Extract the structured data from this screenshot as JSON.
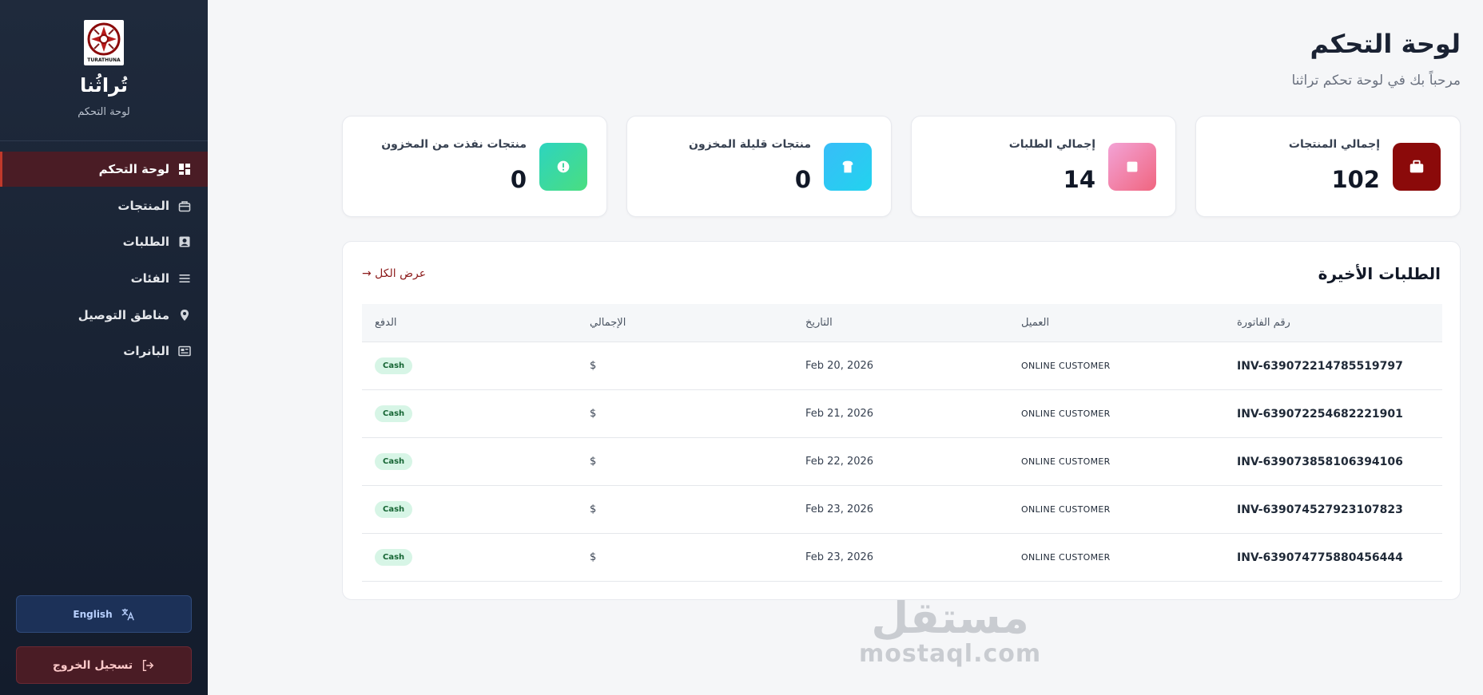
{
  "sidebar": {
    "logo_text": "TURATHUNA",
    "brand_name": "تُراثُنا",
    "brand_sub": "لوحة التحكم",
    "nav": [
      {
        "label": "لوحة التحكم",
        "icon": "dashboard-icon",
        "active": true
      },
      {
        "label": "المنتجات",
        "icon": "products-icon",
        "active": false
      },
      {
        "label": "الطلبات",
        "icon": "orders-icon",
        "active": false
      },
      {
        "label": "الفئات",
        "icon": "categories-icon",
        "active": false
      },
      {
        "label": "مناطق التوصيل",
        "icon": "location-pin-icon",
        "active": false
      },
      {
        "label": "البانرات",
        "icon": "banners-icon",
        "active": false
      }
    ],
    "language_button": "English",
    "logout_button": "تسجيل الخروج"
  },
  "header": {
    "title": "لوحة التحكم",
    "subtitle": "مرحباً بك في لوحة تحكم تراثنا"
  },
  "stats": [
    {
      "label": "إجمالي المنتجات",
      "value": "102",
      "icon": "briefcase-icon",
      "color": "#8b0a0a"
    },
    {
      "label": "إجمالي الطلبات",
      "value": "14",
      "icon": "square-icon",
      "color": "#f472b6"
    },
    {
      "label": "منتجات قليلة المخزون",
      "value": "0",
      "icon": "bread-icon",
      "color": "#22d3ee"
    },
    {
      "label": "منتجات نفذت من المخزون",
      "value": "0",
      "icon": "alert-icon",
      "color": "#34d399"
    }
  ],
  "orders": {
    "title": "الطلبات الأخيرة",
    "view_all": "عرض الكل →",
    "columns": {
      "invoice": "رقم الفاتورة",
      "customer": "العميل",
      "date": "التاريخ",
      "total": "الإجمالي",
      "payment": "الدفع"
    },
    "rows": [
      {
        "invoice": "INV-639072214785519797",
        "customer": "Online Customer",
        "date": "Feb 20, 2026",
        "total": "$",
        "payment": "Cash"
      },
      {
        "invoice": "INV-639072254682221901",
        "customer": "Online Customer",
        "date": "Feb 21, 2026",
        "total": "$",
        "payment": "Cash"
      },
      {
        "invoice": "INV-639073858106394106",
        "customer": "Online Customer",
        "date": "Feb 22, 2026",
        "total": "$",
        "payment": "Cash"
      },
      {
        "invoice": "INV-639074527923107823",
        "customer": "Online Customer",
        "date": "Feb 23, 2026",
        "total": "$",
        "payment": "Cash"
      },
      {
        "invoice": "INV-639074775880456444",
        "customer": "Online Customer",
        "date": "Feb 23, 2026",
        "total": "$",
        "payment": "Cash"
      }
    ]
  },
  "watermark": {
    "arabic": "مستقل",
    "latin": "mostaql.com"
  }
}
